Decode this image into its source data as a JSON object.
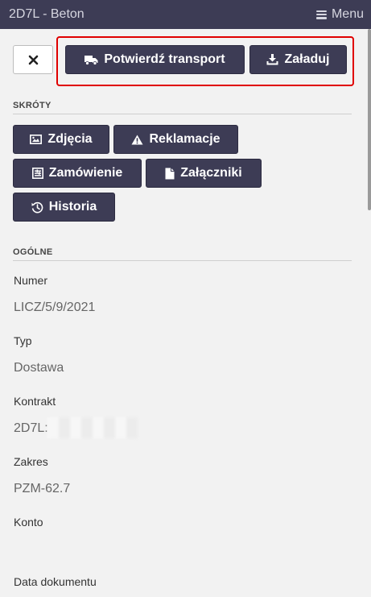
{
  "header": {
    "title": "2D7L - Beton",
    "menu_label": "Menu"
  },
  "toolbar": {
    "confirm_transport_label": "Potwierdź transport",
    "load_label": "Załaduj"
  },
  "shortcuts": {
    "heading": "SKRÓTY",
    "photos_label": "Zdjęcia",
    "complaints_label": "Reklamacje",
    "order_label": "Zamówienie",
    "attachments_label": "Załączniki",
    "history_label": "Historia"
  },
  "general": {
    "heading": "OGÓLNE",
    "fields": [
      {
        "label": "Numer",
        "value": "LICZ/5/9/2021"
      },
      {
        "label": "Typ",
        "value": "Dostawa"
      },
      {
        "label": "Kontrakt",
        "value": "2D7L:"
      },
      {
        "label": "Zakres",
        "value": "PZM-62.7"
      },
      {
        "label": "Konto",
        "value": ""
      },
      {
        "label": "Data dokumentu",
        "value": ""
      }
    ]
  },
  "colors": {
    "primary": "#3d3c55",
    "highlight": "#e00000",
    "background": "#f2f2f2"
  }
}
